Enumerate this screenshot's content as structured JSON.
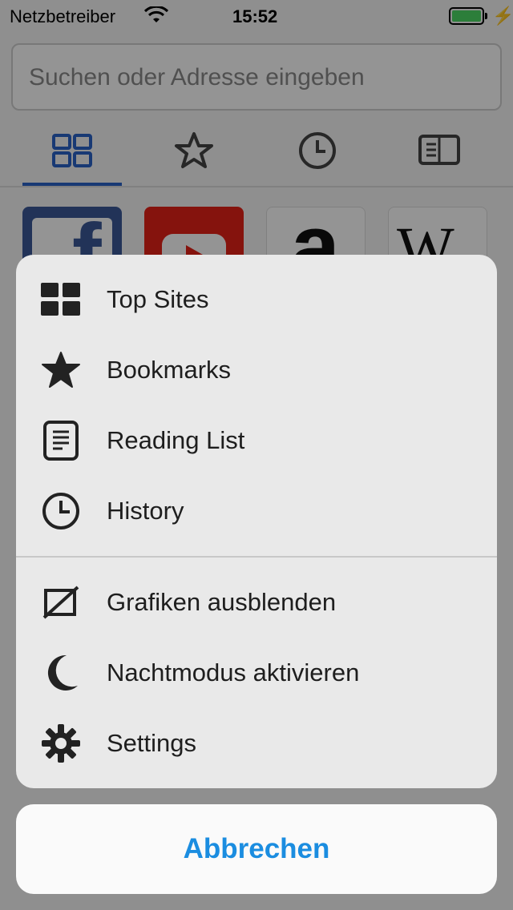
{
  "status_bar": {
    "carrier": "Netzbetreiber",
    "time": "15:52",
    "icons": [
      "wifi-icon",
      "battery-icon",
      "charging-bolt-icon"
    ]
  },
  "url_bar": {
    "placeholder": "Suchen oder Adresse eingeben",
    "value": ""
  },
  "panel_tabs": [
    {
      "icon": "grid-icon",
      "active": true
    },
    {
      "icon": "star-icon",
      "active": false
    },
    {
      "icon": "clock-icon",
      "active": false
    },
    {
      "icon": "reading-list-icon",
      "active": false
    }
  ],
  "top_sites": [
    {
      "icon": "facebook-logo",
      "glyph": "f"
    },
    {
      "icon": "youtube-logo"
    },
    {
      "icon": "amazon-logo",
      "glyph": "a"
    },
    {
      "icon": "wikipedia-logo",
      "glyph": "W"
    }
  ],
  "action_sheet": {
    "items": [
      {
        "label": "Top Sites",
        "icon": "grid-icon"
      },
      {
        "label": "Bookmarks",
        "icon": "star-icon"
      },
      {
        "label": "Reading List",
        "icon": "reading-list-icon"
      },
      {
        "label": "History",
        "icon": "clock-icon"
      },
      {
        "label": "Grafiken ausblenden",
        "icon": "hide-images-icon"
      },
      {
        "label": "Nachtmodus aktivieren",
        "icon": "moon-icon"
      },
      {
        "label": "Settings",
        "icon": "gear-icon"
      }
    ],
    "cancel_label": "Abbrechen"
  },
  "colors": {
    "accent": "#1b8de0",
    "tab_active": "#2a63c9",
    "battery": "#4cd964"
  }
}
